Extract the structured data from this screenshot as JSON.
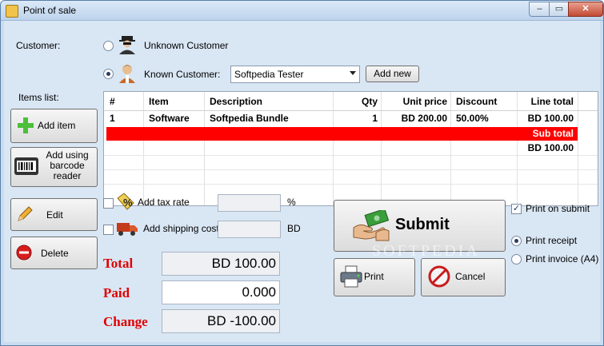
{
  "window": {
    "title": "Point of sale",
    "min_glyph": "–",
    "max_glyph": "▭",
    "close_glyph": "✕"
  },
  "customer": {
    "label": "Customer:",
    "unknown_label": "Unknown  Customer",
    "known_label": "Known Customer:",
    "selected": "Softpedia Tester",
    "add_new": "Add new"
  },
  "items": {
    "label": "Items list:",
    "add_item": "Add item",
    "add_barcode": [
      "Add using",
      "barcode",
      "reader"
    ],
    "edit": "Edit",
    "delete": "Delete"
  },
  "grid": {
    "columns": [
      "#",
      "Item",
      "Description",
      "Qty",
      "Unit price",
      "Discount",
      "Line total"
    ],
    "rows": [
      {
        "num": "1",
        "item": "Software",
        "description": "Softpedia Bundle",
        "qty": "1",
        "unit_price": "BD 200.00",
        "discount": "50.00%",
        "line_total": "BD 100.00"
      }
    ],
    "subtotal_label": "Sub total",
    "subtotal_value": "BD 100.00"
  },
  "options": {
    "tax_label": "Add tax rate",
    "tax_value": "",
    "tax_unit": "%",
    "shipping_label": "Add shipping cost",
    "shipping_value": "",
    "shipping_unit": "BD"
  },
  "totals": {
    "total_label": "Total",
    "total_value": "BD 100.00",
    "paid_label": "Paid",
    "paid_value": "0.000",
    "change_label": "Change",
    "change_value": "BD -100.00"
  },
  "actions": {
    "submit": "Submit",
    "print": "Print",
    "cancel": "Cancel"
  },
  "print_options": {
    "print_on_submit": "Print on submit",
    "print_receipt": "Print receipt",
    "print_invoice": "Print invoice (A4)"
  },
  "watermark": "SOFTPEDIA",
  "colors": {
    "accent_red": "#e00000",
    "subtotal_row": "#ff0000",
    "background": "#d9e6f4"
  }
}
